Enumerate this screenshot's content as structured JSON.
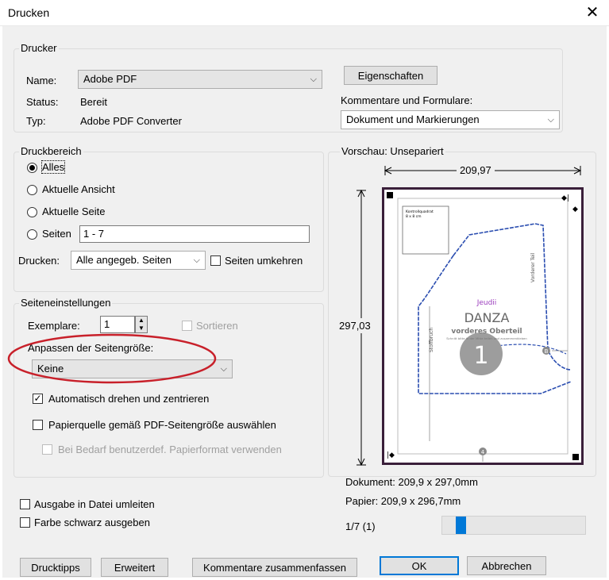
{
  "window": {
    "title": "Drucken",
    "close_glyph": "✕"
  },
  "printer": {
    "legend": "Drucker",
    "name_label": "Name:",
    "name_value": "Adobe PDF",
    "status_label": "Status:",
    "status_value": "Bereit",
    "type_label": "Typ:",
    "type_value": "Adobe PDF Converter",
    "properties_button": "Eigenschaften",
    "comments_label": "Kommentare und Formulare:",
    "comments_value": "Dokument und Markierungen"
  },
  "print_range": {
    "legend": "Druckbereich",
    "options": [
      "Alles",
      "Aktuelle Ansicht",
      "Aktuelle Seite",
      "Seiten"
    ],
    "selected": "Alles",
    "pages_value": "1 - 7",
    "print_label": "Drucken:",
    "print_value": "Alle angegeb. Seiten",
    "reverse_label": "Seiten umkehren",
    "reverse_checked": false
  },
  "page_setup": {
    "legend": "Seiteneinstellungen",
    "copies_label": "Exemplare:",
    "copies_value": "1",
    "collate_label": "Sortieren",
    "fit_label": "Anpassen der Seitengröße:",
    "fit_value": "Keine",
    "auto_rotate_label": "Automatisch drehen und zentrieren",
    "auto_rotate_checked": true,
    "paper_source_label": "Papierquelle gemäß PDF-Seitengröße auswählen",
    "paper_source_checked": false,
    "custom_paper_label": "Bei Bedarf benutzerdef. Papierformat verwenden"
  },
  "output": {
    "to_file_label": "Ausgabe in Datei umleiten",
    "grayscale_label": "Farbe schwarz ausgeben"
  },
  "preview": {
    "title": "Vorschau: Unsepariert",
    "width_value": "209,97",
    "height_value": "297,03",
    "document_size": "Dokument: 209,9 x 297,0mm",
    "paper_size": "Papier: 209,9 x 296,7mm",
    "page_indicator": "1/7 (1)",
    "slider_position": 0.1,
    "sheet": {
      "brand": "Jeudii",
      "model": "DANZA",
      "piece": "vorderes Oberteil",
      "instruction": "Schnitt bitte in der Mitte teilen und zusammenkleben",
      "page_number": "1",
      "left_label": "Stoffbruch",
      "right_label": "Vorderer Teil",
      "corner_box_line1": "Kontrollquadrat",
      "corner_box_line2": "8 x 8 cm",
      "marker_b": "B",
      "marker_4": "4"
    }
  },
  "buttons": {
    "tips": "Drucktipps",
    "advanced": "Erweitert",
    "summarize": "Kommentare zusammenfassen",
    "ok": "OK",
    "cancel": "Abbrechen"
  },
  "colors": {
    "accent": "#0078d7",
    "highlight_oval": "#c8202a",
    "pattern_line": "#2a4db0",
    "sheet_border": "#3a1f3a"
  }
}
